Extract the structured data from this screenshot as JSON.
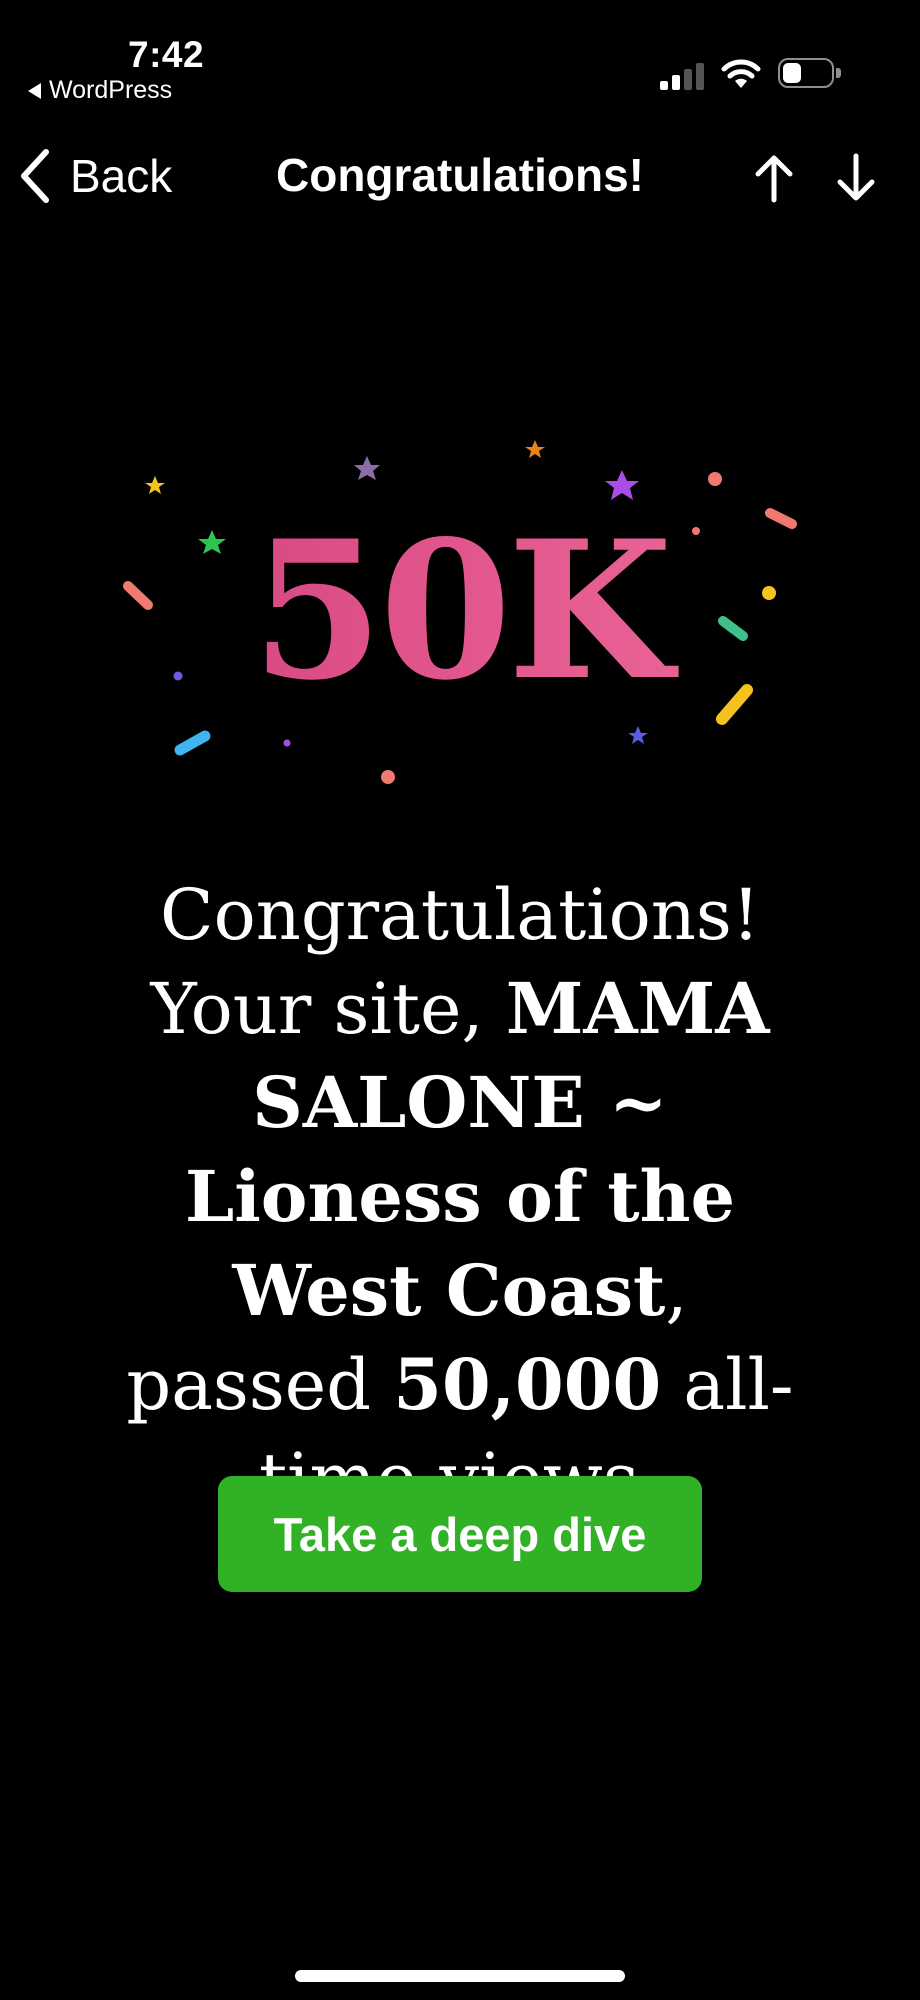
{
  "status_bar": {
    "time": "7:42",
    "back_app": "WordPress"
  },
  "nav": {
    "back_label": "Back",
    "title": "Congratulations!"
  },
  "badge": {
    "number": "50K"
  },
  "message": {
    "line_intro": "Congratulations!",
    "line_prefix": "Your site, ",
    "site_name": "MAMA SALONE ~ Lioness of the West Coast",
    "line_comma": ",",
    "passed": "passed ",
    "count": "50,000",
    "suffix": " all-time views."
  },
  "cta": {
    "label": "Take a deep dive"
  },
  "colors": {
    "cta_green": "#31b226",
    "badge_pink": "#e2568d",
    "background": "#000000"
  }
}
